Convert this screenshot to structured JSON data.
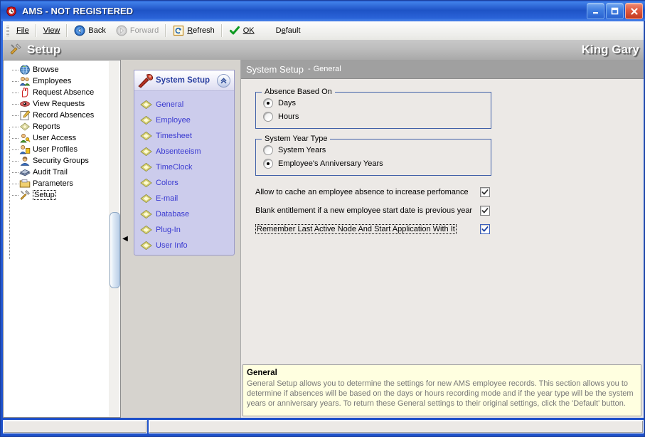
{
  "window": {
    "title_app": "AMS",
    "title_sep": " - ",
    "title_state": "NOT REGISTERED",
    "icon": "alarm-clock-icon",
    "minimize_label": "Minimize",
    "maximize_label": "Maximize",
    "close_label": "Close"
  },
  "toolbar": {
    "file": "File",
    "view": "View",
    "back": "Back",
    "forward": "Forward",
    "refresh": "Refresh",
    "ok": "OK",
    "default": "Default"
  },
  "header": {
    "icon": "tools-icon",
    "title": "Setup",
    "user": "King Gary"
  },
  "tree": {
    "items": [
      {
        "label": "Browse",
        "icon": "globe-icon",
        "selected": false
      },
      {
        "label": "Employees",
        "icon": "people-icon",
        "selected": false
      },
      {
        "label": "Request Absence",
        "icon": "hand-icon",
        "selected": false
      },
      {
        "label": "View Requests",
        "icon": "eye-icon",
        "selected": false
      },
      {
        "label": "Record Absences",
        "icon": "pencil-pad-icon",
        "selected": false
      },
      {
        "label": "Reports",
        "icon": "report-icon",
        "selected": false
      },
      {
        "label": "User Access",
        "icon": "user-key-icon",
        "selected": false
      },
      {
        "label": "User Profiles",
        "icon": "user-card-icon",
        "selected": false
      },
      {
        "label": "Security Groups",
        "icon": "security-icon",
        "selected": false
      },
      {
        "label": "Audit Trail",
        "icon": "books-icon",
        "selected": false
      },
      {
        "label": "Parameters",
        "icon": "folder-icon",
        "selected": false
      },
      {
        "label": "Setup",
        "icon": "tools-icon",
        "selected": true
      }
    ]
  },
  "nav": {
    "panel_title": "System Setup",
    "panel_icon": "wrench-icon",
    "collapse_icon": "chevron-up-icon",
    "items": [
      {
        "label": "General",
        "icon": "diamond-icon"
      },
      {
        "label": "Employee",
        "icon": "diamond-icon"
      },
      {
        "label": "Timesheet",
        "icon": "diamond-icon"
      },
      {
        "label": "Absenteeism",
        "icon": "diamond-icon"
      },
      {
        "label": "TimeClock",
        "icon": "diamond-icon"
      },
      {
        "label": "Colors",
        "icon": "diamond-icon"
      },
      {
        "label": "E-mail",
        "icon": "diamond-icon"
      },
      {
        "label": "Database",
        "icon": "diamond-icon"
      },
      {
        "label": "Plug-In",
        "icon": "diamond-icon"
      },
      {
        "label": "User Info",
        "icon": "diamond-icon"
      }
    ]
  },
  "main": {
    "breadcrumb_primary": "System Setup",
    "breadcrumb_sep": "-",
    "breadcrumb_secondary": "General",
    "group_absence": {
      "legend": "Absence Based On",
      "options": [
        {
          "label": "Days",
          "checked": true
        },
        {
          "label": "Hours",
          "checked": false
        }
      ]
    },
    "group_year": {
      "legend": "System Year Type",
      "options": [
        {
          "label": "System Years",
          "checked": false
        },
        {
          "label": "Employee's Anniversary Years",
          "checked": true
        }
      ]
    },
    "checkboxes": [
      {
        "label": "Allow to cache an employee absence to increase perfomance",
        "checked": true,
        "focused": false,
        "highlight": false
      },
      {
        "label": "Blank entitlement if a new employee start date is previous year",
        "checked": true,
        "focused": false,
        "highlight": false
      },
      {
        "label": "Remember Last Active Node And Start Application With It",
        "checked": true,
        "focused": true,
        "highlight": true
      }
    ],
    "description": {
      "title": "General",
      "text": "General Setup allows you to determine the settings for new AMS employee records.  This section allows you to determine if absences will be based on the days or hours recording mode and if the year type will be the system years or anniversary years. To return these General settings to their original settings, click the 'Default' button."
    }
  },
  "statusbar": {
    "pane_left": "",
    "pane_right": ""
  },
  "colors": {
    "titlebar_blue": "#2b5fd9",
    "nav_panel": "#ccccec",
    "nav_link": "#3a3ad0",
    "group_border": "#4060a8",
    "desc_bg": "#ffffe0",
    "main_bg": "#ece9e6",
    "header_band": "#bdbdbd"
  }
}
